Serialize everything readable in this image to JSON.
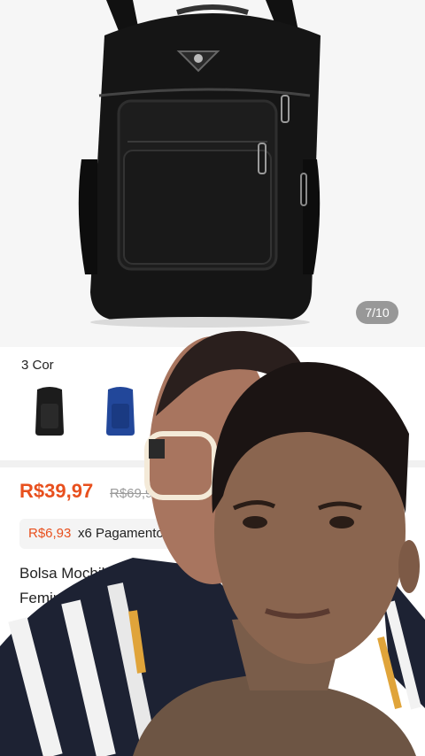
{
  "gallery": {
    "counter": "7/10"
  },
  "variants": {
    "title": "3 Cor",
    "swatches": [
      {
        "name": "black-backpack",
        "color": "#1c1c1c"
      },
      {
        "name": "blue-backpack",
        "color": "#22479a"
      }
    ]
  },
  "price": {
    "current": "R$39,97",
    "original": "R$69,9"
  },
  "installment": {
    "amount": "R$6,93",
    "text": "x6 Pagamento"
  },
  "product": {
    "title_line1": "Bolsa Mochila",
    "title_line2": "Femini"
  },
  "colors": {
    "accent": "#e8501e",
    "muted": "#9a9a9a"
  }
}
